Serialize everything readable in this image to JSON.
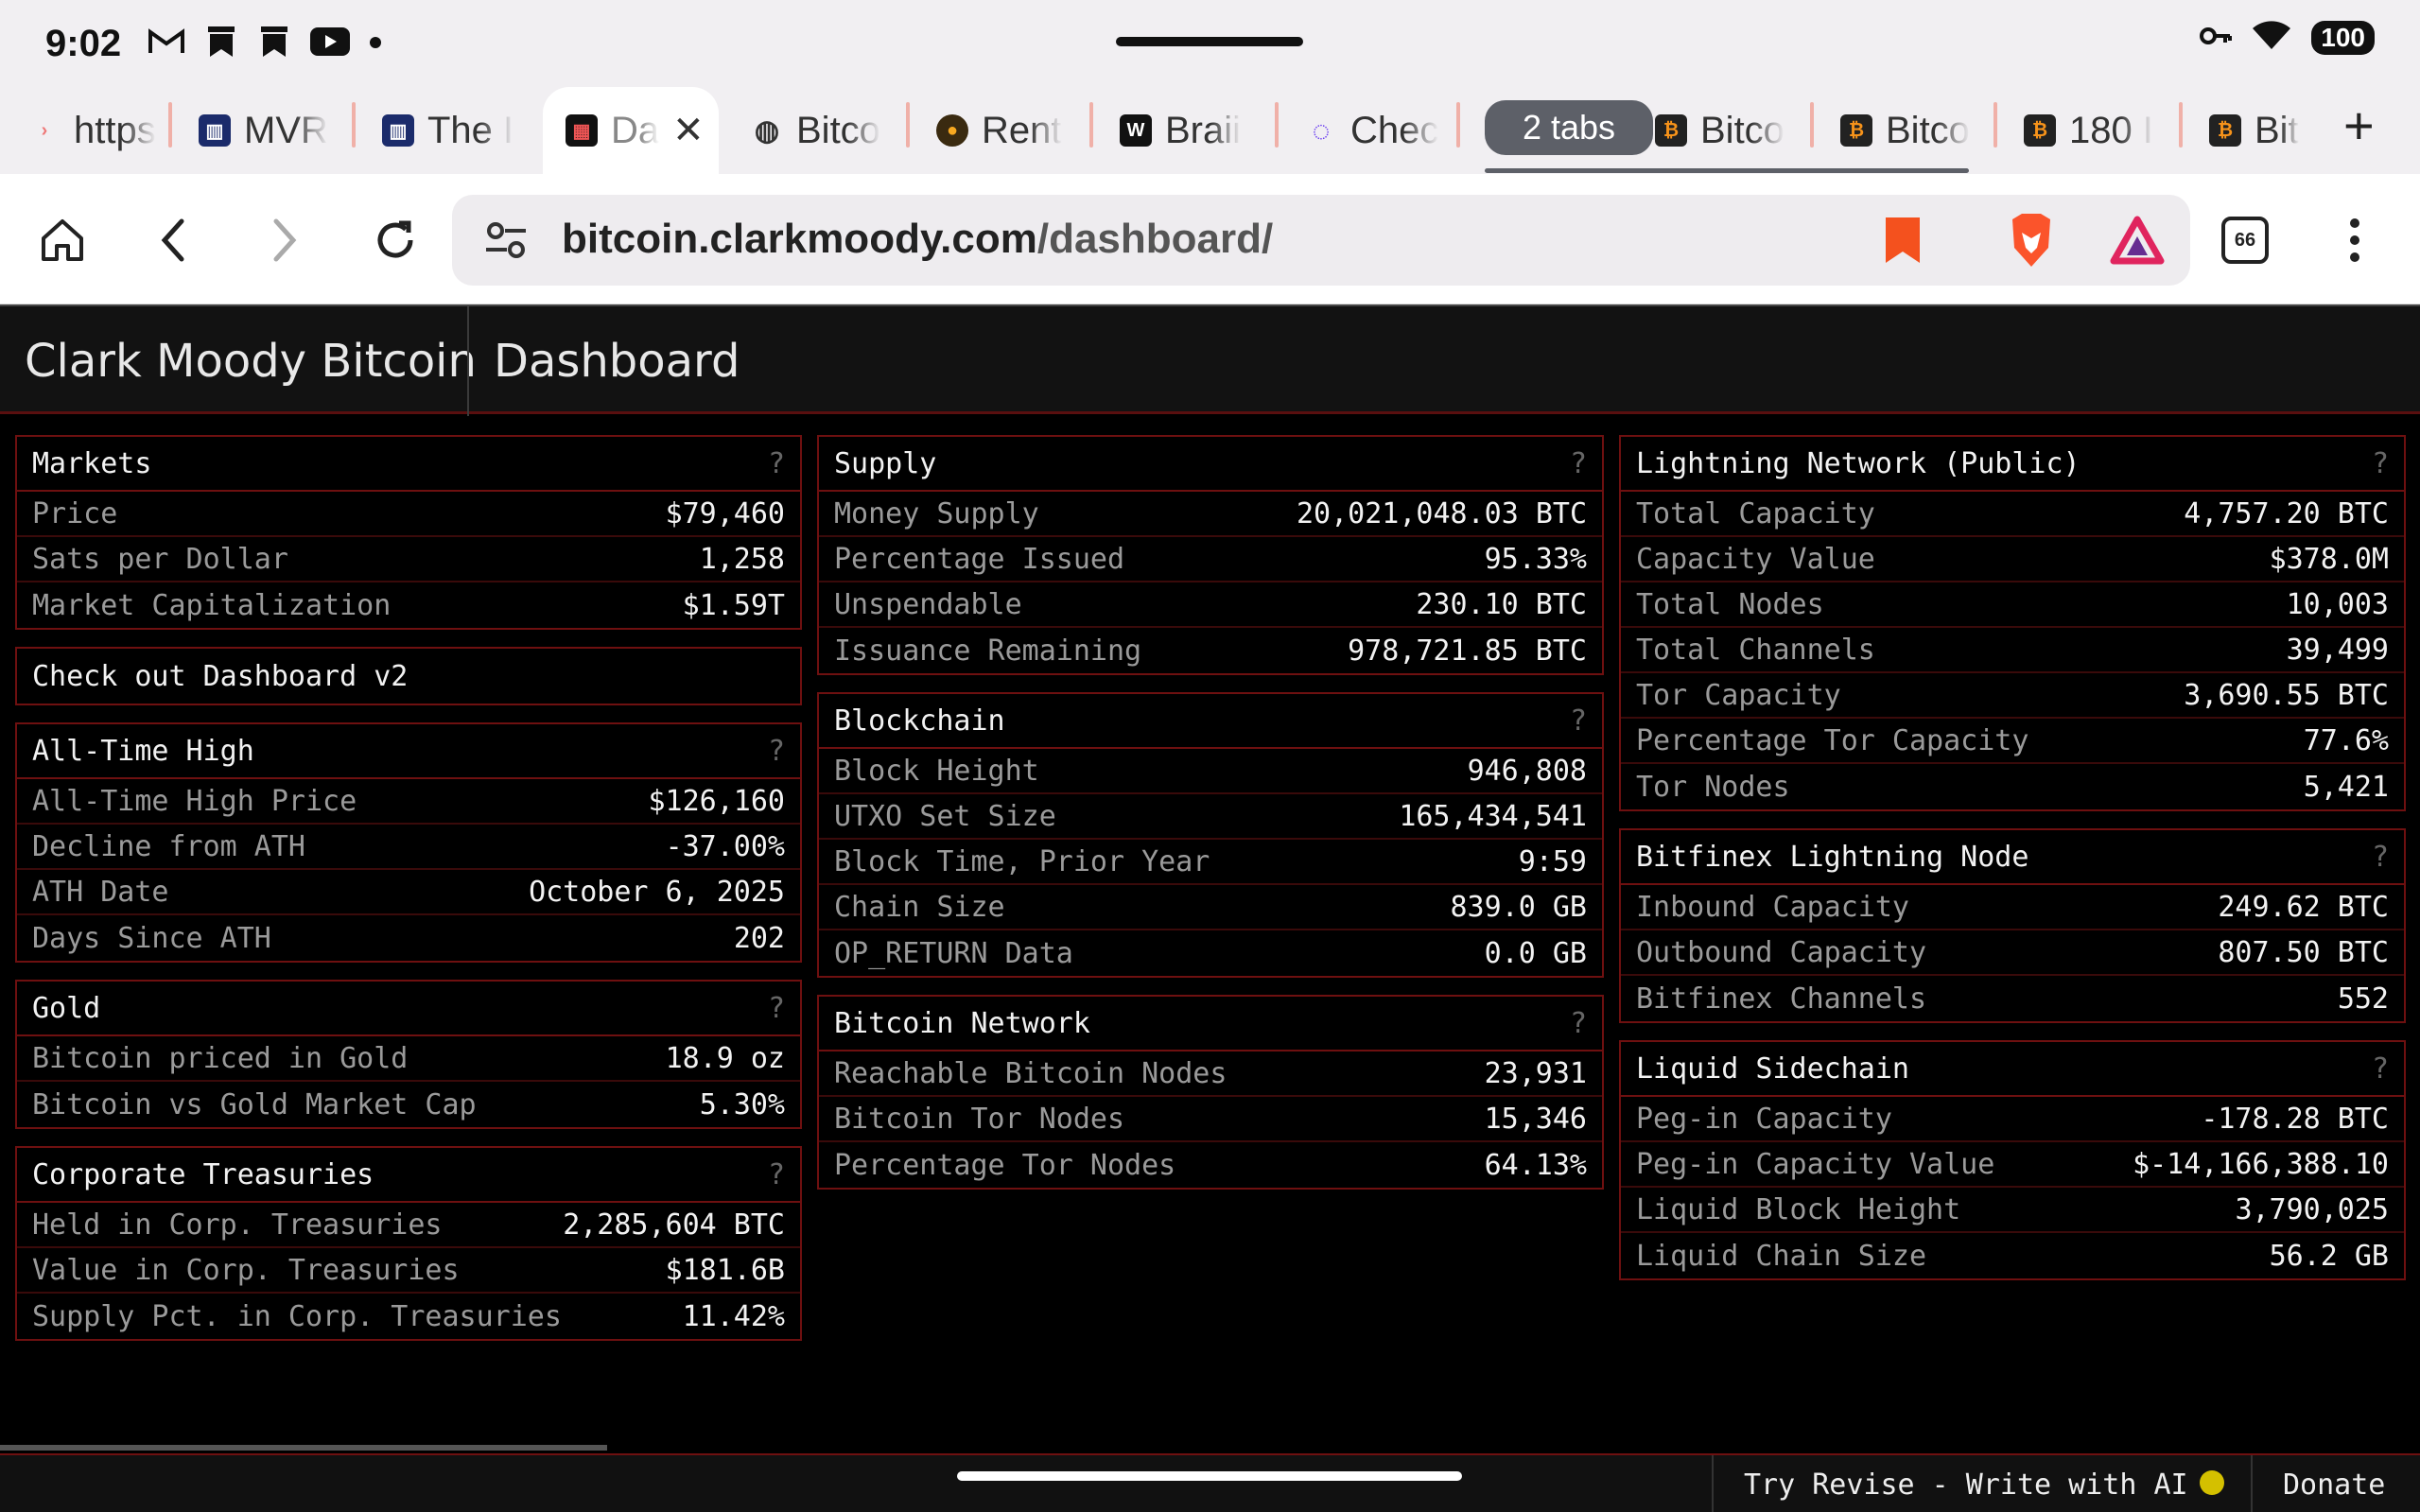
{
  "status": {
    "time": "9:02",
    "battery": "100"
  },
  "tabs": [
    {
      "label": "https",
      "icon": "link-icon"
    },
    {
      "label": "MVR",
      "icon": "chart-icon"
    },
    {
      "label": "The I",
      "icon": "chart-icon"
    },
    {
      "label": "Da",
      "icon": "dashboard-icon",
      "active": true
    },
    {
      "label": "Bitco",
      "icon": "globe-icon"
    },
    {
      "label": "Rent",
      "icon": "coin-icon"
    },
    {
      "label": "Braii",
      "icon": "brain-icon"
    },
    {
      "label": "Chec",
      "icon": "circle-icon"
    },
    {
      "label": "Bitco",
      "icon": "bitcoin-icon"
    },
    {
      "label": "Bitco",
      "icon": "bitcoin-icon"
    },
    {
      "label": "180 I",
      "icon": "bitcoin-icon"
    },
    {
      "label": "Bit",
      "icon": "bitcoin-icon"
    }
  ],
  "tab_group": "2 tabs",
  "url": {
    "host": "bitcoin.clarkmoody.com",
    "path": "/dashboard/",
    "tab_count": "66"
  },
  "site": {
    "title": "Clark Moody Bitcoin",
    "section": "Dashboard"
  },
  "columns": [
    [
      {
        "title": "Markets",
        "rows": [
          [
            "Price",
            "$79,460"
          ],
          [
            "Sats per Dollar",
            "1,258"
          ],
          [
            "Market Capitalization",
            "$1.59T"
          ]
        ]
      },
      {
        "title": "Check out Dashboard v2",
        "link": true,
        "rows": []
      },
      {
        "title": "All-Time High",
        "rows": [
          [
            "All-Time High Price",
            "$126,160"
          ],
          [
            "Decline from ATH",
            "-37.00%"
          ],
          [
            "ATH Date",
            "October 6, 2025"
          ],
          [
            "Days Since ATH",
            "202"
          ]
        ]
      },
      {
        "title": "Gold",
        "rows": [
          [
            "Bitcoin priced in Gold",
            "18.9 oz"
          ],
          [
            "Bitcoin vs Gold Market Cap",
            "5.30%"
          ]
        ]
      },
      {
        "title": "Corporate Treasuries",
        "rows": [
          [
            "Held in Corp. Treasuries",
            "2,285,604 BTC"
          ],
          [
            "Value in Corp. Treasuries",
            "$181.6B"
          ],
          [
            "Supply Pct. in Corp. Treasuries",
            "11.42%"
          ]
        ]
      }
    ],
    [
      {
        "title": "Supply",
        "rows": [
          [
            "Money Supply",
            "20,021,048.03 BTC"
          ],
          [
            "Percentage Issued",
            "95.33%"
          ],
          [
            "Unspendable",
            "230.10 BTC"
          ],
          [
            "Issuance Remaining",
            "978,721.85 BTC"
          ]
        ]
      },
      {
        "title": "Blockchain",
        "rows": [
          [
            "Block Height",
            "946,808"
          ],
          [
            "UTXO Set Size",
            "165,434,541"
          ],
          [
            "Block Time, Prior Year",
            "9:59"
          ],
          [
            "Chain Size",
            "839.0 GB"
          ],
          [
            "OP_RETURN Data",
            "0.0 GB"
          ]
        ]
      },
      {
        "title": "Bitcoin Network",
        "rows": [
          [
            "Reachable Bitcoin Nodes",
            "23,931"
          ],
          [
            "Bitcoin Tor Nodes",
            "15,346"
          ],
          [
            "Percentage Tor Nodes",
            "64.13%"
          ]
        ]
      }
    ],
    [
      {
        "title": "Lightning Network (Public)",
        "rows": [
          [
            "Total Capacity",
            "4,757.20 BTC"
          ],
          [
            "Capacity Value",
            "$378.0M"
          ],
          [
            "Total Nodes",
            "10,003"
          ],
          [
            "Total Channels",
            "39,499"
          ],
          [
            "Tor Capacity",
            "3,690.55 BTC"
          ],
          [
            "Percentage Tor Capacity",
            "77.6%"
          ],
          [
            "Tor Nodes",
            "5,421"
          ]
        ]
      },
      {
        "title": "Bitfinex Lightning Node",
        "rows": [
          [
            "Inbound Capacity",
            "249.62 BTC"
          ],
          [
            "Outbound Capacity",
            "807.50 BTC"
          ],
          [
            "Bitfinex Channels",
            "552"
          ]
        ]
      },
      {
        "title": "Liquid Sidechain",
        "rows": [
          [
            "Peg-in Capacity",
            "-178.28 BTC"
          ],
          [
            "Peg-in Capacity Value",
            "$-14,166,388.10"
          ],
          [
            "Liquid Block Height",
            "3,790,025"
          ],
          [
            "Liquid Chain Size",
            "56.2 GB"
          ]
        ]
      }
    ]
  ],
  "help_glyph": "?",
  "footer": {
    "revise": "Try Revise - Write with AI",
    "donate": "Donate"
  }
}
